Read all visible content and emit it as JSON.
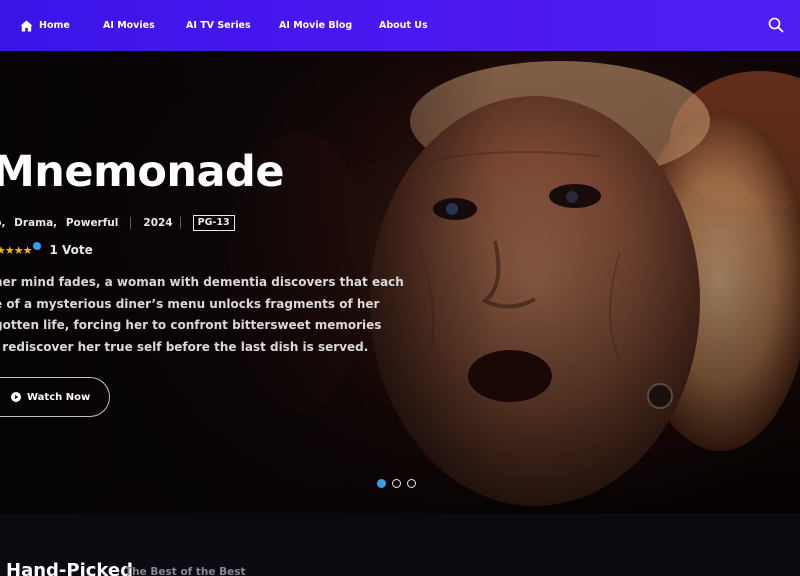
{
  "nav": {
    "items": [
      {
        "label": "Home",
        "icon": "home-icon"
      },
      {
        "label": "AI Movies"
      },
      {
        "label": "AI TV Series"
      },
      {
        "label": "AI Movie Blog"
      },
      {
        "label": "About Us"
      }
    ],
    "search_icon": "search-icon",
    "gradient_start": "#3b14e8",
    "gradient_end": "#4f1ff2"
  },
  "hero": {
    "title": "Mnemonade",
    "genres": [
      "p,",
      "Drama,",
      "Powerful"
    ],
    "year": "2024",
    "rating": "PG-13",
    "stars": "★★★★",
    "votes": "1 Vote",
    "synopsis_lines": [
      "her mind fades, a woman with dementia discovers that each",
      "e of a mysterious diner’s menu unlocks fragments of her",
      "gotten life, forcing her to confront bittersweet memories",
      "l rediscover her true self before the last dish is served."
    ],
    "watch_label": "Watch Now",
    "slides": 3,
    "active_slide": 1,
    "accent_color": "#3aa0e6",
    "star_color": "#f5b50a"
  },
  "section": {
    "title": "Hand-Picked",
    "subtitle": "The Best of the Best"
  }
}
